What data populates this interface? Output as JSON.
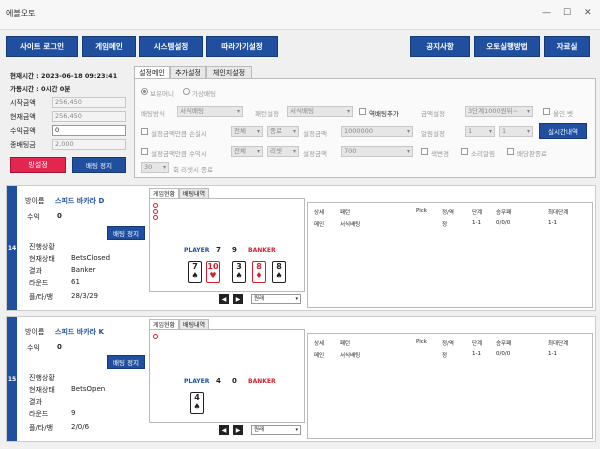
{
  "window": {
    "title": "에볼오토",
    "min": "—",
    "max": "☐",
    "close": "✕"
  },
  "nav": {
    "site_login": "사이트 로그인",
    "game_main": "게임메인",
    "system_settings": "시스템설정",
    "follow_settings": "따라가기설정",
    "notice": "공지사항",
    "auto_howto": "오토실행방법",
    "resources": "자료실"
  },
  "info": {
    "current_time": "현재시간 : 2023-06-18 09:23:41",
    "running_time": "가동시간 : 0시간 0분",
    "start_amount_label": "시작금액",
    "start_amount": "256,450",
    "current_amount_label": "현재금액",
    "current_amount": "256,450",
    "profit_label": "수익금액",
    "profit": "0",
    "close_label": "종배팅금",
    "close": "2,000",
    "stop_button": "방설정",
    "bet_stop_button": "배팅 정지"
  },
  "settings": {
    "tabs": [
      "설정메인",
      "추가설정",
      "체인지설정"
    ],
    "radio_owned": "보유머니",
    "radio_virtual": "가상배팅",
    "bet_method_label": "배팅방식",
    "bet_method": "서식배팅",
    "pattern_label": "패턴설정",
    "pattern": "서식배팅",
    "reverse_bet_label": "역배팅추가",
    "amount_label": "금액설정",
    "amount": "3단계1000원뒤~",
    "all_bet_label": "올인 벳",
    "loss_label": "설정금액만큼 손실시",
    "loss_scope": "전체",
    "loss_action": "종료",
    "loss_amount_label": "설정금액",
    "loss_amount": "1000000",
    "alarm_label": "알림설정",
    "alarm_1": "1",
    "alarm_2": "1",
    "realtime_btn": "실시간내역",
    "profit_label": "설정금액만큼 수익시",
    "profit_scope": "전체",
    "profit_action": "리셋",
    "profit_amount_label": "설정금액",
    "profit_amount": "700",
    "color_change": "색변경",
    "sound_alarm": "소리알림",
    "bet_end": "배당판종료",
    "reset_count": "30",
    "reset_suffix": "회 리셋시 종료"
  },
  "rooms": [
    {
      "number": "14",
      "name_label": "방이름",
      "name": "스피드 바카라 D",
      "profit_label": "수익",
      "profit": "0",
      "bet_stop": "배팅 정지",
      "progress_label": "진행상황",
      "state_label": "현재상태",
      "state": "BetsClosed",
      "result_label": "결과",
      "result": "Banker",
      "round_label": "라운드",
      "round": "61",
      "stats_label": "플/타/뱅",
      "stats": "28/3/29",
      "tabs": [
        "게임현황",
        "배팅내역"
      ],
      "player_label": "PLAYER",
      "player_score": "7",
      "banker_score": "9",
      "banker_label": "BANKER",
      "dropdown": "원래",
      "grid_headers": [
        "상세",
        "패턴",
        "Pick",
        "정/역",
        "단계",
        "승무패",
        "최대단계"
      ],
      "grid_row": [
        "메인",
        "서식배팅",
        "",
        "정",
        "1-1",
        "0/0/0",
        "1-1"
      ]
    },
    {
      "number": "15",
      "name_label": "방이름",
      "name": "스피드 바카라 K",
      "profit_label": "수익",
      "profit": "0",
      "bet_stop": "배팅 정지",
      "progress_label": "진행상황",
      "state_label": "현재상태",
      "state": "BetsOpen",
      "result_label": "결과",
      "result": "",
      "round_label": "라운드",
      "round": "9",
      "stats_label": "플/타/뱅",
      "stats": "2/0/6",
      "tabs": [
        "게임현황",
        "배팅내역"
      ],
      "player_label": "PLAYER",
      "player_score": "4",
      "banker_score": "0",
      "banker_label": "BANKER",
      "dropdown": "원래",
      "grid_headers": [
        "상세",
        "패턴",
        "Pick",
        "정/역",
        "단계",
        "승무패",
        "최대단계"
      ],
      "grid_row": [
        "메인",
        "서식배팅",
        "",
        "정",
        "1-1",
        "0/0/0",
        "1-1"
      ]
    }
  ],
  "cards": {
    "room14_player": [
      {
        "rank": "7",
        "suit": "♠",
        "red": false
      },
      {
        "rank": "10",
        "suit": "♥",
        "red": true
      }
    ],
    "room14_banker": [
      {
        "rank": "3",
        "suit": "♠",
        "red": false
      },
      {
        "rank": "8",
        "suit": "♦",
        "red": true
      },
      {
        "rank": "8",
        "suit": "♠",
        "red": false
      }
    ],
    "room15_player": [
      {
        "rank": "4",
        "suit": "♠",
        "red": false
      }
    ]
  },
  "colors": {
    "nav_blue": "#1f4f9e",
    "stop_red": "#e32650",
    "card_red": "#d4202e"
  }
}
